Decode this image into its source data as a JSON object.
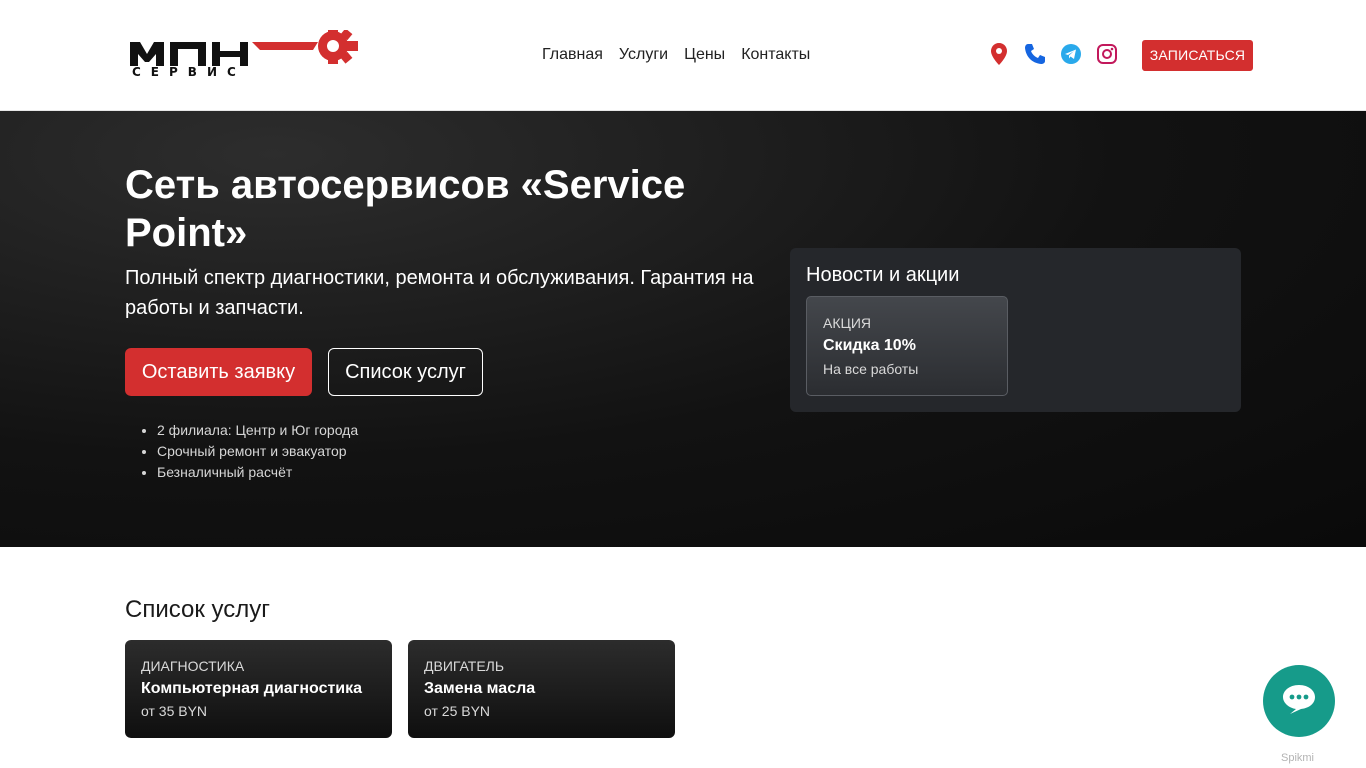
{
  "header": {
    "logo_text": "МПН СЕРВИС",
    "nav": [
      {
        "label": "Главная"
      },
      {
        "label": "Услуги"
      },
      {
        "label": "Цены"
      },
      {
        "label": "Контакты"
      }
    ],
    "icons": [
      "location-icon",
      "phone-icon",
      "telegram-icon",
      "instagram-icon"
    ],
    "cta_label": "ЗАПИСАТЬСЯ"
  },
  "hero": {
    "title": "Сеть автосервисов «Service Point»",
    "subtitle": "Полный спектр диагностики, ремонта и обслуживания. Гарантия на работы и запчасти.",
    "primary_button": "Оставить заявку",
    "secondary_button": "Список услуг",
    "features": [
      "2 филиала: Центр и Юг города",
      "Срочный ремонт и эвакуатор",
      "Безналичный расчёт"
    ]
  },
  "news": {
    "title": "Новости и акции",
    "items": [
      {
        "tag": "АКЦИЯ",
        "headline": "Скидка 10%",
        "description": "На все работы"
      }
    ]
  },
  "services": {
    "title": "Список услуг",
    "items": [
      {
        "tag": "ДИАГНОСТИКА",
        "name": "Компьютерная диагностика",
        "price": "от 35 BYN"
      },
      {
        "tag": "ДВИГАТЕЛЬ",
        "name": "Замена масла",
        "price": "от 25 BYN"
      }
    ]
  },
  "chat_widget": {
    "brand": "Spikmi"
  },
  "colors": {
    "accent": "#d32f2f",
    "chat": "#169b8a",
    "hero_bg": "#121212"
  }
}
